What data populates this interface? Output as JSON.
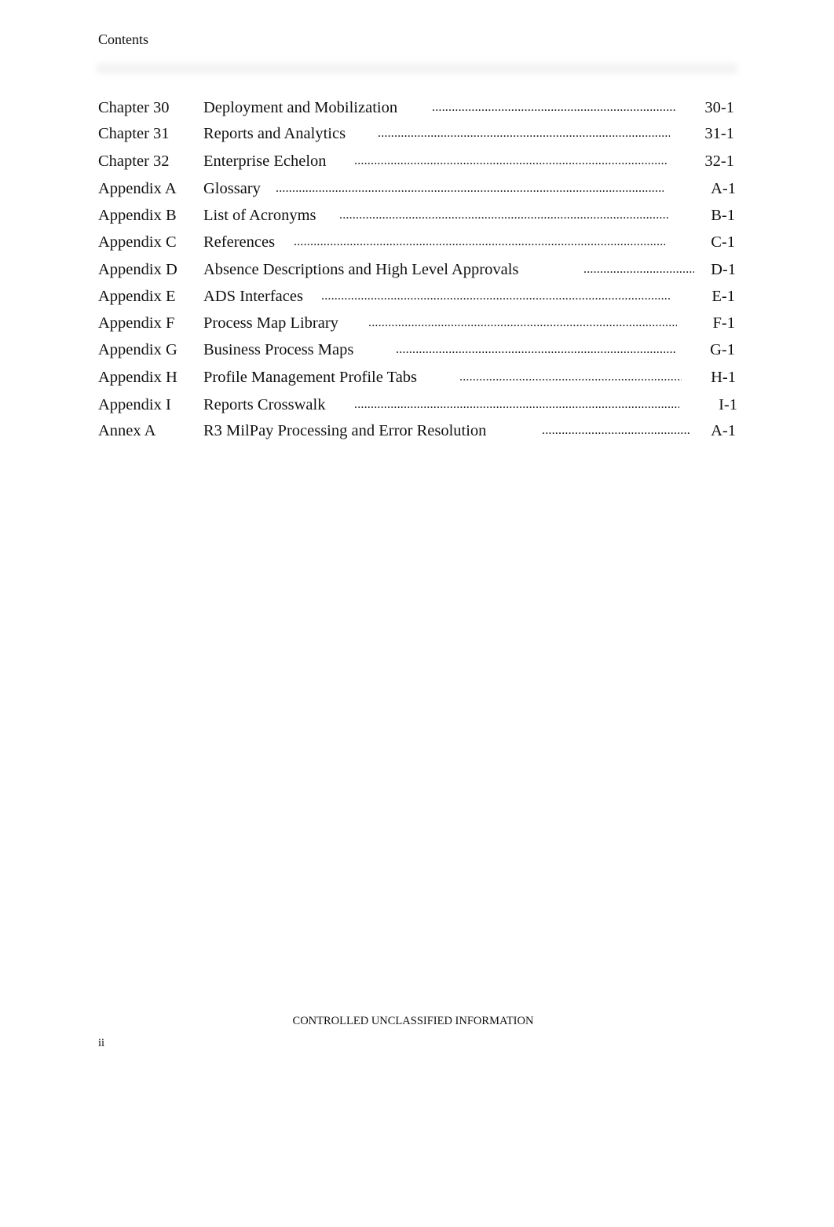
{
  "header": {
    "title": "Contents"
  },
  "toc": {
    "entries": [
      {
        "label": "Chapter 30",
        "title": "Deployment and Mobilization",
        "page": "30-1"
      },
      {
        "label": "Chapter 31",
        "title": "Reports and Analytics",
        "page": "31-1"
      },
      {
        "label": "Chapter 32",
        "title": "Enterprise Echelon",
        "page": "32-1"
      },
      {
        "label": "Appendix A",
        "title": "Glossary",
        "page": "A-1"
      },
      {
        "label": "Appendix B",
        "title": "List of Acronyms",
        "page": "B-1"
      },
      {
        "label": "Appendix C",
        "title": "References",
        "page": "C-1"
      },
      {
        "label": "Appendix D",
        "title": "Absence Descriptions and High Level Approvals",
        "page": "D-1"
      },
      {
        "label": "Appendix E",
        "title": "ADS Interfaces",
        "page": "E-1"
      },
      {
        "label": "Appendix F",
        "title": "Process Map Library",
        "page": "F-1"
      },
      {
        "label": "Appendix G",
        "title": "Business Process Maps",
        "page": "G-1"
      },
      {
        "label": "Appendix H",
        "title": "Profile Management Profile Tabs",
        "page": "H-1"
      },
      {
        "label": "Appendix I",
        "title": "Reports Crosswalk",
        "page": "I-1"
      },
      {
        "label": "Annex A",
        "title": "R3 MilPay Processing and Error Resolution",
        "page": "A-1"
      }
    ]
  },
  "footer": {
    "banner": "CONTROLLED UNCLASSIFIED INFORMATION",
    "page_number": "ii"
  }
}
